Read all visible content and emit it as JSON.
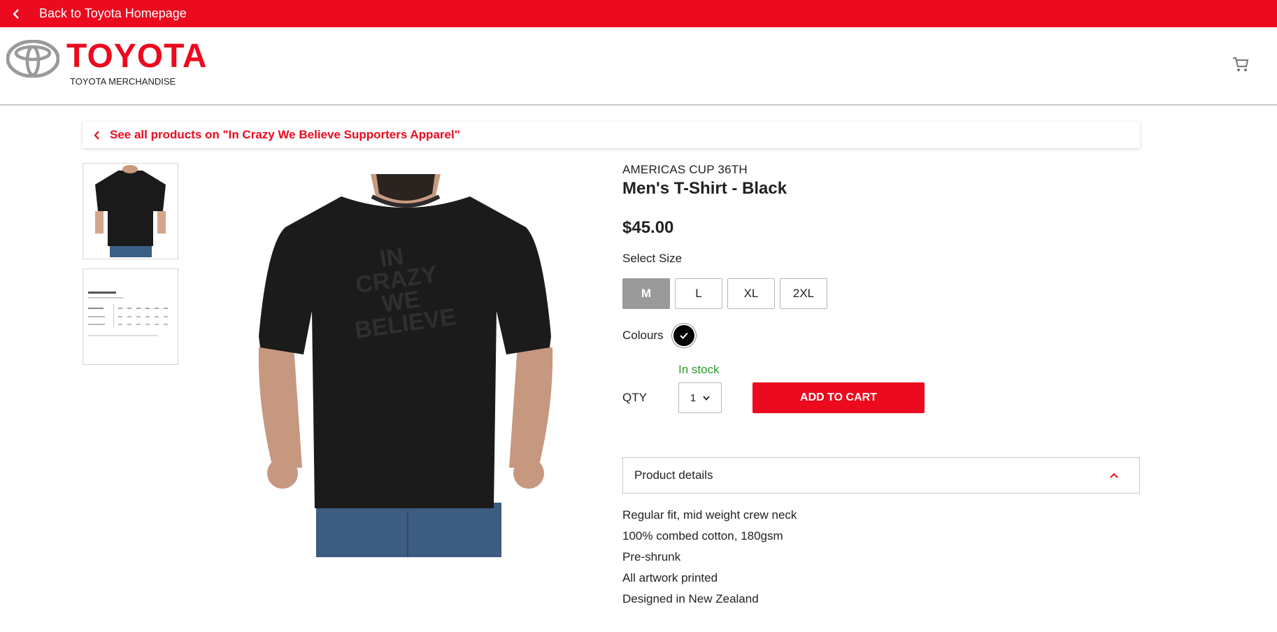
{
  "topbar": {
    "back_label": "Back to Toyota Homepage"
  },
  "header": {
    "brand": "TOYOTA",
    "subtitle": "TOYOTA MERCHANDISE"
  },
  "breadcrumb": {
    "label": "See all products on \"In Crazy We Believe Supporters Apparel\""
  },
  "product": {
    "collection": "AMERICAS CUP 36TH",
    "title": "Men's T-Shirt - Black",
    "price": "$45.00",
    "print_text": [
      "IN",
      "CRAZY",
      "WE",
      "BELIEVE"
    ],
    "size_label": "Select Size",
    "sizes": [
      "M",
      "L",
      "XL",
      "2XL"
    ],
    "selected_size": "M",
    "colours_label": "Colours",
    "stock": "In stock",
    "qty_label": "QTY",
    "qty_value": "1",
    "add_to_cart": "ADD TO CART",
    "details_label": "Product details",
    "details": [
      "Regular fit, mid weight crew neck",
      "100% combed cotton, 180gsm",
      "Pre-shrunk",
      "All artwork printed",
      "Designed in New Zealand"
    ]
  },
  "colors": {
    "brand_red": "#eb0a1e",
    "stock_green": "#2a9a2a",
    "selected_size_bg": "#9a9a9a"
  },
  "icons": [
    "chevron-left-icon",
    "toyota-emblem-icon",
    "cart-icon",
    "check-icon",
    "chevron-down-icon",
    "chevron-up-icon"
  ]
}
